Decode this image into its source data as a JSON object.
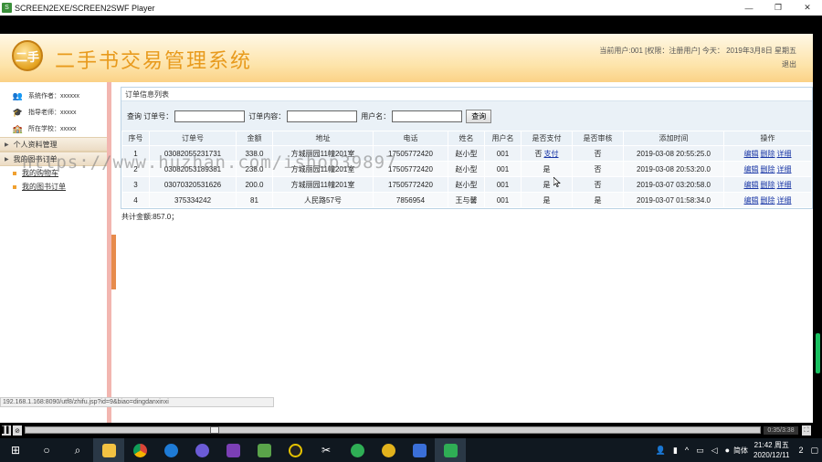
{
  "window": {
    "title": "SCREEN2EXE/SCREEN2SWF Player",
    "minimize": "—",
    "maximize": "❐",
    "close": "✕"
  },
  "header": {
    "logo_text": "二手",
    "system_title": "二手书交易管理系统",
    "user_info": "当前用户:001 [权限：注册用户] 今天：  2019年3月8日  星期五",
    "logout": "退出"
  },
  "sidebar": {
    "info": [
      {
        "label": "系统作者：xxxxxx",
        "icon": "users-icon"
      },
      {
        "label": "指导老师：xxxxx",
        "icon": "teacher-icon"
      },
      {
        "label": "所在学校：xxxxx",
        "icon": "school-icon"
      }
    ],
    "menus": [
      {
        "title": "个人资料管理",
        "items": []
      },
      {
        "title": "我的图书订单",
        "items": [
          "我的购物车",
          "我的图书订单"
        ]
      }
    ]
  },
  "main": {
    "panel_title": "订单信息列表",
    "search": {
      "label_query": "查询",
      "label_order_no": "订单号：",
      "label_content": "订单内容：",
      "label_user": "用户名：",
      "button": "查询"
    },
    "columns": [
      "序号",
      "订单号",
      "金额",
      "地址",
      "电话",
      "姓名",
      "用户名",
      "是否支付",
      "是否审核",
      "添加时间",
      "操作"
    ],
    "rows": [
      {
        "idx": "1",
        "order_no": "03082055231731",
        "amount": "338.0",
        "address": "方城丽园11幢201室",
        "phone": "17505772420",
        "name": "赵小型",
        "user": "001",
        "paid": "否",
        "pay_link": "支付",
        "audited": "否",
        "time": "2019-03-08 20:55:25.0"
      },
      {
        "idx": "2",
        "order_no": "03082053189381",
        "amount": "238.0",
        "address": "方城丽园11幢201室",
        "phone": "17505772420",
        "name": "赵小型",
        "user": "001",
        "paid": "是",
        "pay_link": "",
        "audited": "否",
        "time": "2019-03-08 20:53:20.0"
      },
      {
        "idx": "3",
        "order_no": "03070320531626",
        "amount": "200.0",
        "address": "方城丽园11幢201室",
        "phone": "17505772420",
        "name": "赵小型",
        "user": "001",
        "paid": "是",
        "pay_link": "",
        "audited": "否",
        "time": "2019-03-07 03:20:58.0"
      },
      {
        "idx": "4",
        "order_no": "375334242",
        "amount": "81",
        "address": "人民路57号",
        "phone": "7856954",
        "name": "王与馨",
        "user": "001",
        "paid": "是",
        "pay_link": "",
        "audited": "是",
        "time": "2019-03-07 01:58:34.0"
      }
    ],
    "actions": {
      "edit": "编辑",
      "delete": "删除",
      "detail": "详细"
    },
    "total": "共计金额:857.0；"
  },
  "status_url": "192.168.1.168:8090/utf8/zhifu.jsp?id=9&biao=dingdanxinxi",
  "watermark": "https://www.huzhan.com/ishop39897",
  "player": {
    "time": "0:35/3:38",
    "play": "▌▌",
    "stop": "⊘",
    "fullscreen": "⛶"
  },
  "taskbar": {
    "start": "⊞",
    "apps": [
      "cortana-icon",
      "search-icon",
      "file-explorer-icon",
      "chrome-icon",
      "edge-icon",
      "media-icon",
      "app-icon",
      "app-icon",
      "qq-icon",
      "tool-icon",
      "app-icon",
      "app-icon",
      "app-icon",
      "screen2exe-icon"
    ],
    "ime": "简体",
    "time": "21:42 周五",
    "date": "2020/12/11",
    "notif_count": "2"
  },
  "colors": {
    "header_orange": "#e89a1c",
    "link_blue": "#1a37a6",
    "sidebar_border": "#f2b6b0"
  }
}
